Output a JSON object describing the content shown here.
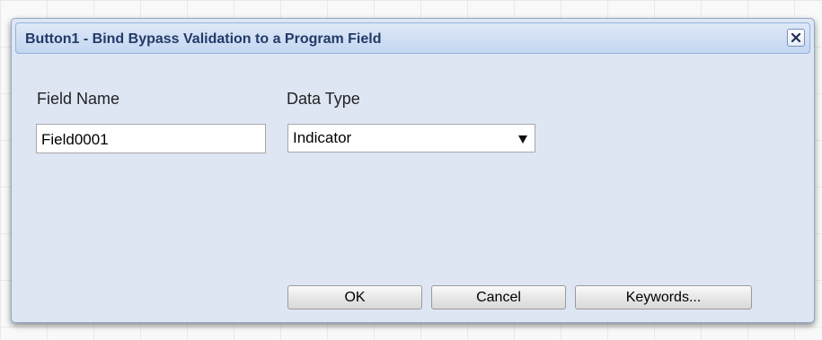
{
  "dialog": {
    "title": "Button1 - Bind Bypass Validation to a Program Field",
    "close_icon": "close-icon"
  },
  "form": {
    "field_name_label": "Field Name",
    "field_name_value": "Field0001",
    "data_type_label": "Data Type",
    "data_type_selected": "Indicator",
    "data_type_arrow_icon": "dropdown-arrow-icon"
  },
  "buttons": {
    "ok": "OK",
    "cancel": "Cancel",
    "keywords": "Keywords..."
  }
}
